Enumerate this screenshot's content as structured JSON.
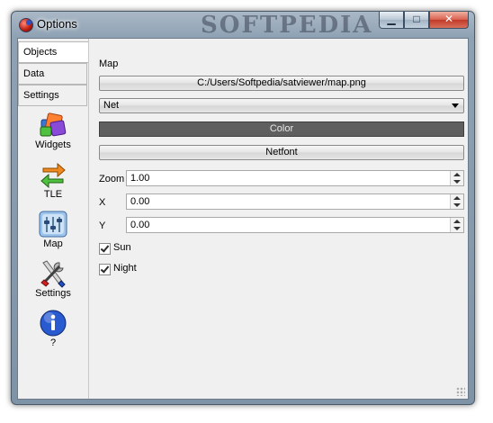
{
  "window": {
    "title": "Options",
    "watermark": "SOFTPEDIA",
    "buttons": {
      "minimize": "▁",
      "maximize": "□",
      "close": "✕"
    }
  },
  "sidebar": {
    "tabs": [
      "Objects",
      "Data",
      "Settings"
    ],
    "active_tab": "Objects",
    "items": [
      {
        "label": "Widgets",
        "icon": "widgets-icon"
      },
      {
        "label": "TLE",
        "icon": "tle-arrows-icon"
      },
      {
        "label": "Map",
        "icon": "map-sliders-icon"
      },
      {
        "label": "Settings",
        "icon": "tools-icon"
      },
      {
        "label": "?",
        "icon": "info-icon"
      }
    ]
  },
  "map_panel": {
    "section_label": "Map",
    "map_path": "C:/Users/Softpedia/satviewer/map.png",
    "projection_selected": "Net",
    "color_label": "Color",
    "font_label": "Netfont",
    "colors": {
      "color_swatch": "#5f5f5f"
    },
    "fields": [
      {
        "label": "Zoom",
        "value": "1.00"
      },
      {
        "label": "X",
        "value": "0.00"
      },
      {
        "label": "Y",
        "value": "0.00"
      }
    ],
    "checkboxes": [
      {
        "label": "Sun",
        "checked": true
      },
      {
        "label": "Night",
        "checked": true
      }
    ]
  }
}
